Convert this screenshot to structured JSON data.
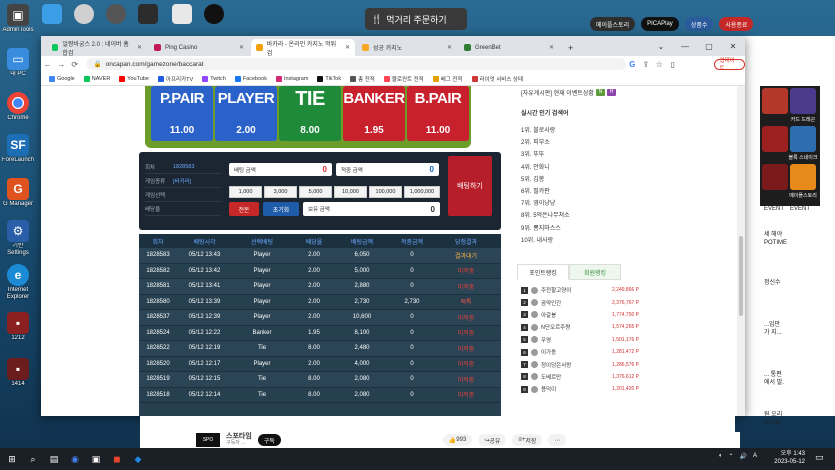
{
  "desktop": {
    "icons": [
      {
        "label": "AdminTools"
      },
      {
        "label": "내 PC"
      },
      {
        "label": "Chrome"
      },
      {
        "label": "ForeLauncher"
      },
      {
        "label": "G Manager"
      },
      {
        "label": "기반 Settings"
      },
      {
        "label": "Internet Explorer"
      },
      {
        "label": "1212"
      },
      {
        "label": "1414"
      }
    ],
    "live_banner": "먹거리 주문하기",
    "right_pills": [
      "메이플스토리",
      "PICAPlay",
      "상품수",
      "사용종료"
    ],
    "side_game_labels": [
      "카드 드래곤",
      "블록 스네이크",
      "메이플스토리"
    ],
    "side_text": [
      "EVENT",
      "EVENT",
      "세 해야",
      "POTIME",
      "정신수",
      "...입만",
      "가 지...",
      "... 통편",
      "에서 발.",
      "원 오리",
      "보내겠"
    ]
  },
  "browser": {
    "tabs": [
      {
        "label": "얼짱바궁스 2.0 : 네이버 홈합검"
      },
      {
        "label": "Ping Casino"
      },
      {
        "label": "바카라 - 온라인 카지노 먹튀 검"
      },
      {
        "label": "성공 카지노"
      },
      {
        "label": "GreenBet"
      }
    ],
    "url": "oncapan.com/gamezone/baccarat",
    "update_label": "업데이트",
    "bookmarks": [
      "Google",
      "NAVER",
      "YouTube",
      "아프리카TV",
      "Twitch",
      "Facebook",
      "Instagram",
      "TikTok",
      "총 전적",
      "블로컨트 전적",
      "배그 전적",
      "라이엇 서비스 상태"
    ]
  },
  "board": {
    "bets": [
      {
        "name": "P.PAIR",
        "odds": "11.00",
        "color": "#2b62c9"
      },
      {
        "name": "PLAYER",
        "odds": "2.00",
        "color": "#2b62c9"
      },
      {
        "name": "TIE",
        "odds": "8.00",
        "color": "#1f8a3a"
      },
      {
        "name": "BANKER",
        "odds": "1.95",
        "color": "#c8202c"
      },
      {
        "name": "B.PAIR",
        "odds": "11.00",
        "color": "#c8202c"
      }
    ]
  },
  "control": {
    "info": [
      {
        "k": "회차",
        "v": "1828583"
      },
      {
        "k": "게임종류",
        "v": "[바카라]"
      },
      {
        "k": "게임선택",
        "v": ""
      },
      {
        "k": "배당율",
        "v": ""
      }
    ],
    "bet_amount_label": "배팅 금액",
    "bet_amount": "0",
    "win_amount_label": "적중 금액",
    "win_amount": "0",
    "chips": [
      "1,000",
      "3,000",
      "5,000",
      "10,000",
      "100,000",
      "1,000,000"
    ],
    "max_label": "전돈",
    "reset_label": "초기화",
    "holding_label": "보유 금액",
    "holding": "0",
    "bet_button": "배팅하기"
  },
  "history": {
    "headers": [
      "회차",
      "배팅시각",
      "선택배팅",
      "배당율",
      "배팅금액",
      "적중금액",
      "당첨결과"
    ],
    "rows": [
      {
        "round": "1828583",
        "time": "05/12 13:43",
        "pick": "Player",
        "odds": "2.00",
        "bet": "6,050",
        "win": "0",
        "result": "결과대기",
        "cls": "res-wait"
      },
      {
        "round": "1828582",
        "time": "05/12 13:42",
        "pick": "Player",
        "odds": "2.00",
        "bet": "5,000",
        "win": "0",
        "result": "미적중",
        "cls": "res-lose"
      },
      {
        "round": "1828581",
        "time": "05/12 13:41",
        "pick": "Player",
        "odds": "2.00",
        "bet": "2,880",
        "win": "0",
        "result": "미적중",
        "cls": "res-lose"
      },
      {
        "round": "1828580",
        "time": "05/12 13:39",
        "pick": "Player",
        "odds": "2.00",
        "bet": "2,730",
        "win": "2,730",
        "result": "적특",
        "cls": "res-hit"
      },
      {
        "round": "1828537",
        "time": "05/12 12:39",
        "pick": "Player",
        "odds": "2.00",
        "bet": "10,600",
        "win": "0",
        "result": "미적중",
        "cls": "res-lose"
      },
      {
        "round": "1828524",
        "time": "05/12 12:22",
        "pick": "Banker",
        "odds": "1.95",
        "bet": "8,100",
        "win": "0",
        "result": "미적중",
        "cls": "res-lose"
      },
      {
        "round": "1828522",
        "time": "05/12 12:19",
        "pick": "Tie",
        "odds": "8.00",
        "bet": "2,480",
        "win": "0",
        "result": "미적중",
        "cls": "res-lose"
      },
      {
        "round": "1828520",
        "time": "05/12 12:17",
        "pick": "Player",
        "odds": "2.00",
        "bet": "4,000",
        "win": "0",
        "result": "미적중",
        "cls": "res-lose"
      },
      {
        "round": "1828519",
        "time": "05/12 12:15",
        "pick": "Tie",
        "odds": "8.00",
        "bet": "2,080",
        "win": "0",
        "result": "미적중",
        "cls": "res-lose"
      },
      {
        "round": "1828518",
        "time": "05/12 12:14",
        "pick": "Tie",
        "odds": "8.00",
        "bet": "2,080",
        "win": "0",
        "result": "미적중",
        "cls": "res-lose"
      }
    ]
  },
  "rightcol": {
    "event_text": "[자유게시판] 현재 이벤트상황",
    "popular_title": "실시간 인기 검색어",
    "popular": [
      "1위. 블로사랑",
      "2위. 피부소",
      "3위. 뚜뚜",
      "4위. 안화니",
      "5위. 김봉",
      "6위. 필카판",
      "7위. 영이냥냥",
      "8위. 5억은나무쳐소",
      "9위. 뿅지마스스",
      "10위. 내사랑"
    ],
    "rank_tabs": [
      "포인트랭킹",
      "회원랭킹"
    ],
    "ranks": [
      {
        "n": "1",
        "name": "주전할고양이",
        "pt": "2,249,866 P"
      },
      {
        "n": "2",
        "name": "곰약인간",
        "pt": "2,376,767 P"
      },
      {
        "n": "3",
        "name": "아갈봉",
        "pt": "1,774,750 P"
      },
      {
        "n": "4",
        "name": "N단오르주짱",
        "pt": "1,574,265 P"
      },
      {
        "n": "5",
        "name": "우영",
        "pt": "1,501,176 P"
      },
      {
        "n": "6",
        "name": "이가동",
        "pt": "1,281,472 P"
      },
      {
        "n": "7",
        "name": "정이덩은사랑",
        "pt": "1,286,576 P"
      },
      {
        "n": "8",
        "name": "도베르만",
        "pt": "1,376,612 P"
      },
      {
        "n": "9",
        "name": "용덕이",
        "pt": "1,201,420 P"
      }
    ]
  },
  "youtube": {
    "channel": "스포타임",
    "subtitle": "구독자 ...",
    "subscribe": "구독",
    "likes": "993",
    "share": "공유",
    "save": "저장"
  },
  "taskbar": {
    "time": "오후 1:43",
    "date": "2023-05-12"
  }
}
